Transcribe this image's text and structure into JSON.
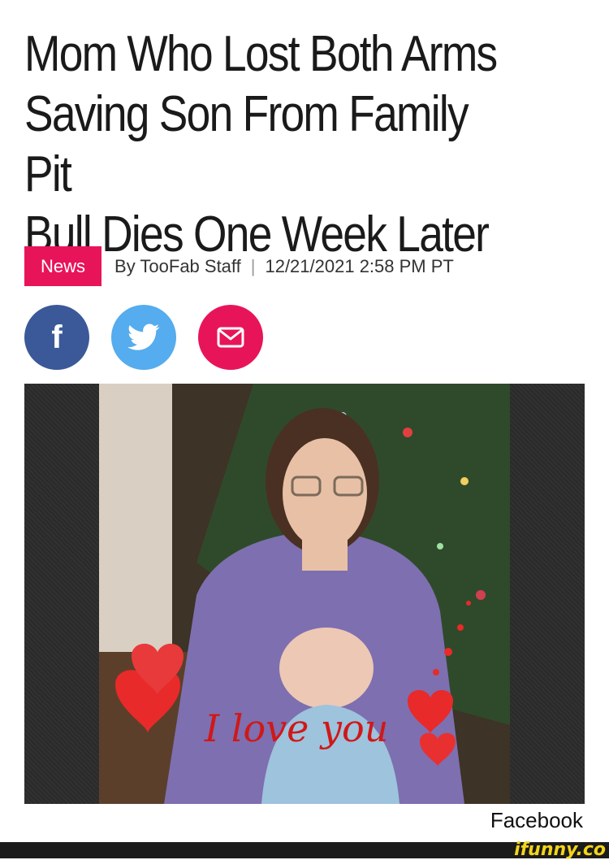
{
  "article": {
    "headline": "Mom Who Lost Both Arms\nSaving Son From Family Pit\nBull Dies One Week Later",
    "category": "News",
    "byline": "By TooFab Staff",
    "separator": "|",
    "timestamp": "12/21/2021 2:58 PM PT",
    "photo_caption": "Facebook"
  },
  "photo": {
    "overlay_text": "I love you"
  },
  "share": [
    {
      "network": "facebook",
      "icon": "facebook-icon",
      "glyph": "f",
      "color": "#3b5998"
    },
    {
      "network": "twitter",
      "icon": "twitter-bird-icon",
      "color": "#55acee"
    },
    {
      "network": "email",
      "icon": "envelope-icon",
      "color": "#e8145a"
    }
  ],
  "colors": {
    "accent": "#e8145a",
    "facebook": "#3b5998",
    "twitter": "#55acee",
    "watermark": "#f4d41a"
  },
  "watermark": {
    "text": "ifunny.co"
  }
}
